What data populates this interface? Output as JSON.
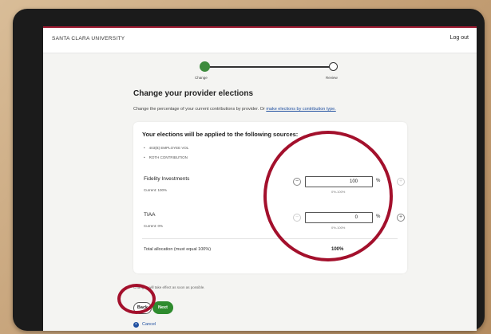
{
  "header": {
    "brand": "SANTA CLARA UNIVERSITY",
    "logout": "Log out"
  },
  "stepper": {
    "steps": [
      "Change",
      "Review"
    ],
    "active": 1
  },
  "page": {
    "title": "Change your provider elections",
    "intro_text": "Change the percentage of your current contributions by provider. Or ",
    "intro_link": "make elections by contribution type."
  },
  "card": {
    "heading": "Your elections will be applied to the following sources:",
    "sources": [
      "403(B) EMPLOYEE VOL",
      "ROTH CONTRIBUTION"
    ],
    "funds": [
      {
        "name": "Fidelity Investments",
        "current": "Current: 100%",
        "value": "100",
        "unit": "%",
        "range": "0%-100%"
      },
      {
        "name": "TIAA",
        "current": "Current: 0%",
        "value": "0",
        "unit": "%",
        "range": "0%-100%"
      }
    ],
    "total_label": "Total allocation (must equal 100%)",
    "total_value": "100%"
  },
  "footer": {
    "note": "Changes will take effect as soon as possible.",
    "back": "Back",
    "next": "Next",
    "cancel": "Cancel"
  },
  "icons": {
    "minus": "minus-icon",
    "plus": "plus-icon",
    "cancel": "close-icon"
  },
  "colors": {
    "accent_red": "#9e1b32",
    "primary_green": "#2e8b2e",
    "link_blue": "#1f4fa0",
    "annotation_red": "#a3102c"
  }
}
